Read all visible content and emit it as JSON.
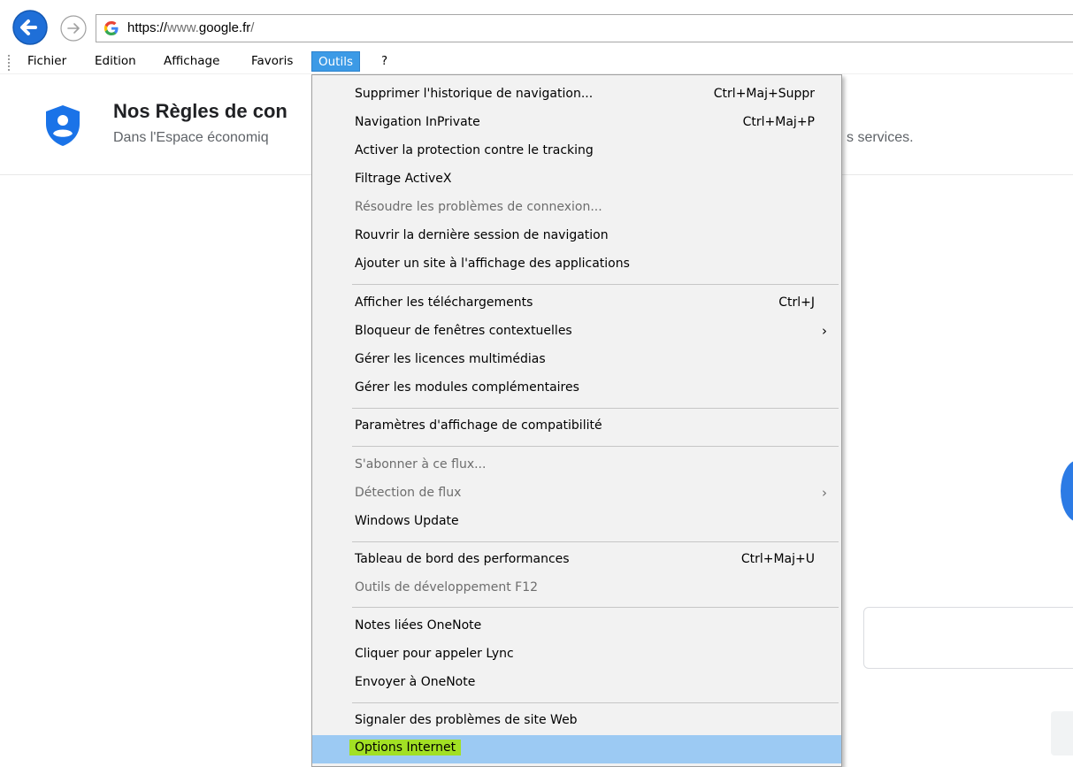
{
  "address_bar": {
    "url_scheme": "https://",
    "url_sub": "www.",
    "url_host": "google.fr",
    "url_tail": "/"
  },
  "menubar": {
    "items": [
      "Fichier",
      "Edition",
      "Affichage",
      "Favoris",
      "Outils",
      "?"
    ],
    "active": "Outils"
  },
  "page": {
    "title": "Nos Règles de con",
    "subtitle": "Dans l'Espace économiq",
    "subtitle_right": "s services."
  },
  "tools_menu": {
    "items": [
      {
        "label": "Supprimer l'historique de navigation...",
        "shortcut": "Ctrl+Maj+Suppr"
      },
      {
        "label": "Navigation InPrivate",
        "shortcut": "Ctrl+Maj+P"
      },
      {
        "label": "Activer la protection contre le tracking"
      },
      {
        "label": "Filtrage ActiveX"
      },
      {
        "label": "Résoudre les problèmes de connexion...",
        "disabled": true
      },
      {
        "label": "Rouvrir la dernière session de navigation"
      },
      {
        "label": "Ajouter un site à l'affichage des applications"
      },
      {
        "label": "Afficher les téléchargements",
        "shortcut": "Ctrl+J"
      },
      {
        "label": "Bloqueur de fenêtres contextuelles",
        "submenu": "›"
      },
      {
        "label": "Gérer les licences multimédias"
      },
      {
        "label": "Gérer les modules complémentaires"
      },
      {
        "label": "Paramètres d'affichage de compatibilité"
      },
      {
        "label": "S'abonner à ce flux...",
        "disabled": true
      },
      {
        "label": "Détection de flux",
        "disabled": true,
        "submenu": "›"
      },
      {
        "label": "Windows Update"
      },
      {
        "label": "Tableau de bord des performances",
        "shortcut": "Ctrl+Maj+U"
      },
      {
        "label": "Outils de développement F12",
        "disabled": true
      },
      {
        "label": "Notes liées OneNote"
      },
      {
        "label": "Cliquer pour appeler Lync"
      },
      {
        "label": "Envoyer à OneNote"
      },
      {
        "label": "Signaler des problèmes de site Web"
      },
      {
        "label": "Options Internet",
        "highlighted": true
      }
    ]
  },
  "colors": {
    "menu_active": "#3c9ae6",
    "menu_hover": "#9ccaf3",
    "highlight_marker": "#a2e024",
    "back_button": "#1a73e8",
    "shield": "#1a73e8"
  }
}
